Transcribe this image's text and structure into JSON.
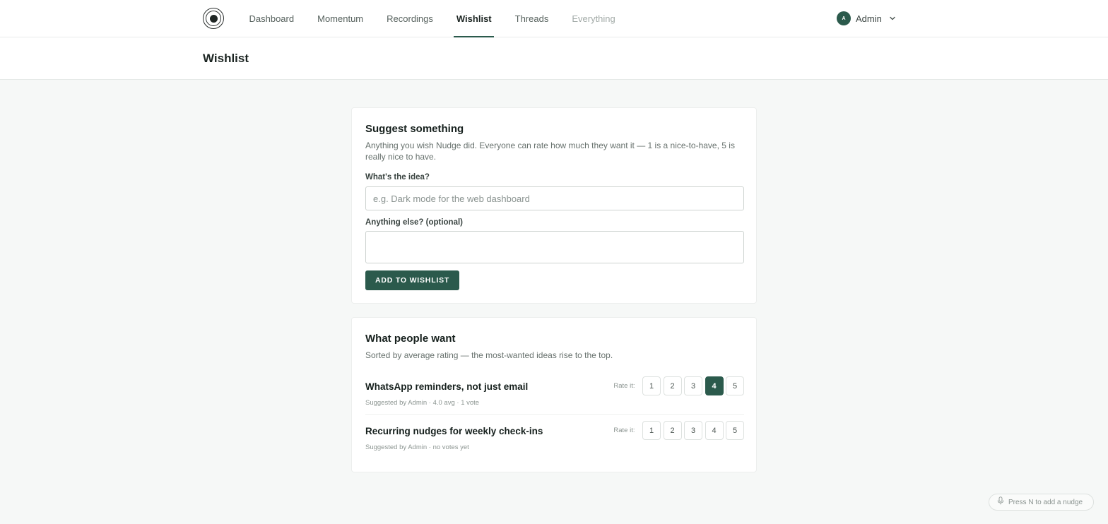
{
  "nav": {
    "items": [
      {
        "label": "Dashboard",
        "state": "normal"
      },
      {
        "label": "Momentum",
        "state": "normal"
      },
      {
        "label": "Recordings",
        "state": "normal"
      },
      {
        "label": "Wishlist",
        "state": "active"
      },
      {
        "label": "Threads",
        "state": "normal"
      },
      {
        "label": "Everything",
        "state": "muted"
      }
    ],
    "logo_icon": "target-logo-icon"
  },
  "user": {
    "initial": "A",
    "name": "Admin",
    "menu_icon": "chevron-down-icon"
  },
  "page": {
    "title": "Wishlist"
  },
  "suggest": {
    "title": "Suggest something",
    "description": "Anything you wish Nudge did. Everyone can rate how much they want it — 1 is a nice-to-have, 5 is really nice to have.",
    "idea_label": "What's the idea?",
    "idea_value": "",
    "idea_placeholder": "e.g. Dark mode for the web dashboard",
    "details_label": "Anything else? (optional)",
    "details_value": "",
    "submit_label": "ADD TO WISHLIST"
  },
  "list": {
    "title": "What people want",
    "description": "Sorted by average rating — the most-wanted ideas rise to the top.",
    "rate_label": "Rate it:",
    "ratings": [
      "1",
      "2",
      "3",
      "4",
      "5"
    ],
    "items": [
      {
        "title": "WhatsApp reminders, not just email",
        "meta": "Suggested by Admin · 4.0 avg · 1 vote",
        "selected": "4"
      },
      {
        "title": "Recurring nudges for weekly check-ins",
        "meta": "Suggested by Admin · no votes yet",
        "selected": null
      }
    ]
  },
  "hint": {
    "icon": "microphone-icon",
    "text": "Press N to add a nudge"
  },
  "colors": {
    "accent": "#2b5a4c",
    "background": "#f6f8f7"
  }
}
